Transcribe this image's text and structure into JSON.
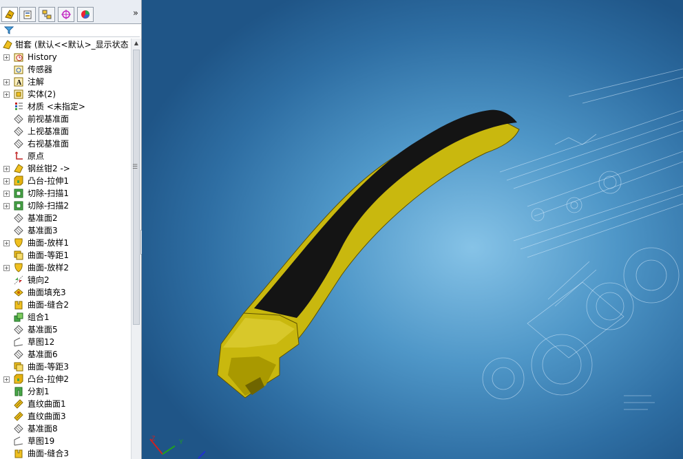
{
  "feature_tree": {
    "root_label": "钳套 (默认<<默认>_显示状态",
    "items": [
      {
        "label": "History",
        "icon": "history-icon",
        "expand": true
      },
      {
        "label": "传感器",
        "icon": "sensor-icon",
        "expand": false
      },
      {
        "label": "注解",
        "icon": "annotation-icon",
        "expand": true
      },
      {
        "label": "实体(2)",
        "icon": "solid-bodies-icon",
        "expand": true
      },
      {
        "label": "材质 <未指定>",
        "icon": "material-icon",
        "expand": false
      },
      {
        "label": "前视基准面",
        "icon": "plane-icon",
        "expand": false
      },
      {
        "label": "上视基准面",
        "icon": "plane-icon",
        "expand": false
      },
      {
        "label": "右视基准面",
        "icon": "plane-icon",
        "expand": false
      },
      {
        "label": "原点",
        "icon": "origin-icon",
        "expand": false
      },
      {
        "label": "钢丝钳2 ->",
        "icon": "part-icon",
        "expand": true
      },
      {
        "label": "凸台-拉伸1",
        "icon": "boss-extrude-icon",
        "expand": true
      },
      {
        "label": "切除-扫描1",
        "icon": "cut-sweep-icon",
        "expand": true
      },
      {
        "label": "切除-扫描2",
        "icon": "cut-sweep-icon",
        "expand": true
      },
      {
        "label": "基准面2",
        "icon": "plane-icon",
        "expand": false
      },
      {
        "label": "基准面3",
        "icon": "plane-icon",
        "expand": false
      },
      {
        "label": "曲面-放样1",
        "icon": "surface-loft-icon",
        "expand": true
      },
      {
        "label": "曲面-等距1",
        "icon": "surface-offset-icon",
        "expand": false
      },
      {
        "label": "曲面-放样2",
        "icon": "surface-loft-icon",
        "expand": true
      },
      {
        "label": "镜向2",
        "icon": "mirror-icon",
        "expand": false
      },
      {
        "label": "曲面填充3",
        "icon": "surface-fill-icon",
        "expand": false
      },
      {
        "label": "曲面-缝合2",
        "icon": "surface-knit-icon",
        "expand": false
      },
      {
        "label": "组合1",
        "icon": "combine-icon",
        "expand": false
      },
      {
        "label": "基准面5",
        "icon": "plane-icon",
        "expand": false
      },
      {
        "label": "草图12",
        "icon": "sketch-icon",
        "expand": false
      },
      {
        "label": "基准面6",
        "icon": "plane-icon",
        "expand": false
      },
      {
        "label": "曲面-等距3",
        "icon": "surface-offset-icon",
        "expand": false
      },
      {
        "label": "凸台-拉伸2",
        "icon": "boss-extrude-icon",
        "expand": true
      },
      {
        "label": "分割1",
        "icon": "split-icon",
        "expand": false
      },
      {
        "label": "直纹曲面1",
        "icon": "ruled-surface-icon",
        "expand": false
      },
      {
        "label": "直纹曲面3",
        "icon": "ruled-surface-icon",
        "expand": false
      },
      {
        "label": "基准面8",
        "icon": "plane-icon",
        "expand": false
      },
      {
        "label": "草图19",
        "icon": "sketch-icon",
        "expand": false
      },
      {
        "label": "曲面-缝合3",
        "icon": "surface-knit-icon",
        "expand": false
      }
    ]
  },
  "panel_tabs": [
    "featuremanager-tab",
    "propertymanager-tab",
    "configurationmanager-tab",
    "dimxpert-tab",
    "display-manager-tab"
  ],
  "expand_glyph": "»",
  "colors": {
    "handle_black": "#141414",
    "handle_yellow": "#c9b80e",
    "viewport_bg": "#4f97c8"
  },
  "triad": {
    "x": "X",
    "y": "Y",
    "z": "Z"
  }
}
